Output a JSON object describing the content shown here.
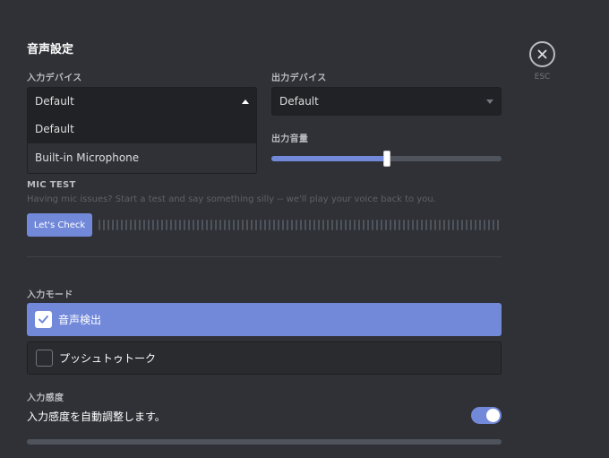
{
  "settings": {
    "title": "音声設定",
    "input_device": {
      "label": "入力デバイス",
      "value": "Default",
      "options": [
        "Default",
        "Built-in Microphone"
      ]
    },
    "output_device": {
      "label": "出力デバイス",
      "value": "Default"
    },
    "output_volume": {
      "label": "出力音量",
      "level_percent": 50
    },
    "mic_test": {
      "label": "MIC TEST",
      "description": "Having mic issues? Start a test and say something silly -- we'll play your voice back to you.",
      "button_label": "Let's Check"
    },
    "input_mode": {
      "label": "入力モード",
      "options": [
        {
          "label": "音声検出",
          "checked": true
        },
        {
          "label": "プッシュトゥトーク",
          "checked": false
        }
      ]
    },
    "input_sensitivity": {
      "label": "入力感度",
      "auto_label": "入力感度を自動調整します。",
      "auto_enabled": true
    },
    "close": {
      "label": "ESC",
      "icon": "close-icon"
    }
  },
  "colors": {
    "background": "#2f3136",
    "accent": "#7289da",
    "input_bg": "#202225"
  }
}
